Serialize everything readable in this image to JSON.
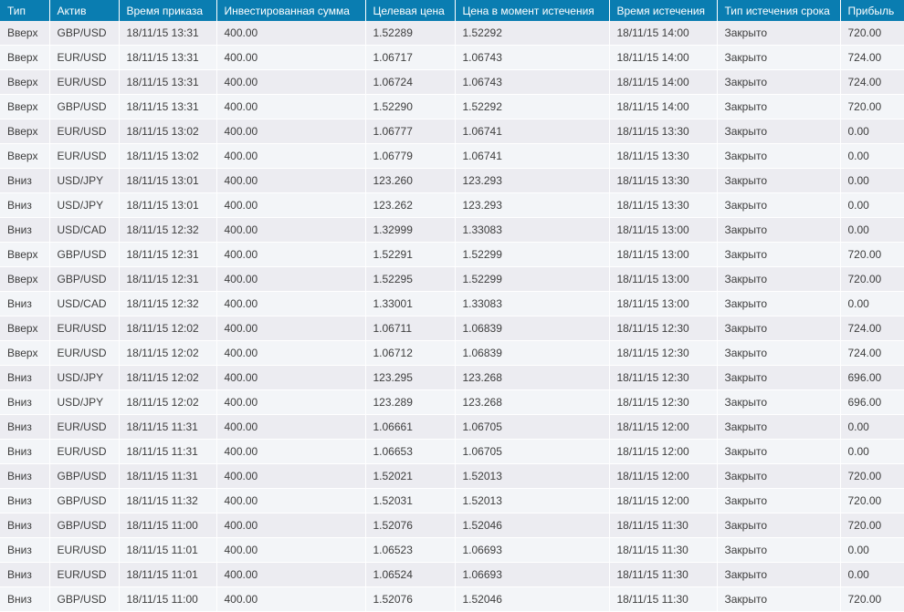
{
  "headers": [
    "Тип",
    "Актив",
    "Время приказа",
    "Инвестированная сумма",
    "Целевая цена",
    "Цена в момент истечения",
    "Время истечения",
    "Тип истечения срока",
    "Прибыль"
  ],
  "rows": [
    [
      "Вверх",
      "GBP/USD",
      "18/11/15 13:31",
      "400.00",
      "1.52289",
      "1.52292",
      "18/11/15 14:00",
      "Закрыто",
      "720.00"
    ],
    [
      "Вверх",
      "EUR/USD",
      "18/11/15 13:31",
      "400.00",
      "1.06717",
      "1.06743",
      "18/11/15 14:00",
      "Закрыто",
      "724.00"
    ],
    [
      "Вверх",
      "EUR/USD",
      "18/11/15 13:31",
      "400.00",
      "1.06724",
      "1.06743",
      "18/11/15 14:00",
      "Закрыто",
      "724.00"
    ],
    [
      "Вверх",
      "GBP/USD",
      "18/11/15 13:31",
      "400.00",
      "1.52290",
      "1.52292",
      "18/11/15 14:00",
      "Закрыто",
      "720.00"
    ],
    [
      "Вверх",
      "EUR/USD",
      "18/11/15 13:02",
      "400.00",
      "1.06777",
      "1.06741",
      "18/11/15 13:30",
      "Закрыто",
      "0.00"
    ],
    [
      "Вверх",
      "EUR/USD",
      "18/11/15 13:02",
      "400.00",
      "1.06779",
      "1.06741",
      "18/11/15 13:30",
      "Закрыто",
      "0.00"
    ],
    [
      "Вниз",
      "USD/JPY",
      "18/11/15 13:01",
      "400.00",
      "123.260",
      "123.293",
      "18/11/15 13:30",
      "Закрыто",
      "0.00"
    ],
    [
      "Вниз",
      "USD/JPY",
      "18/11/15 13:01",
      "400.00",
      "123.262",
      "123.293",
      "18/11/15 13:30",
      "Закрыто",
      "0.00"
    ],
    [
      "Вниз",
      "USD/CAD",
      "18/11/15 12:32",
      "400.00",
      "1.32999",
      "1.33083",
      "18/11/15 13:00",
      "Закрыто",
      "0.00"
    ],
    [
      "Вверх",
      "GBP/USD",
      "18/11/15 12:31",
      "400.00",
      "1.52291",
      "1.52299",
      "18/11/15 13:00",
      "Закрыто",
      "720.00"
    ],
    [
      "Вверх",
      "GBP/USD",
      "18/11/15 12:31",
      "400.00",
      "1.52295",
      "1.52299",
      "18/11/15 13:00",
      "Закрыто",
      "720.00"
    ],
    [
      "Вниз",
      "USD/CAD",
      "18/11/15 12:32",
      "400.00",
      "1.33001",
      "1.33083",
      "18/11/15 13:00",
      "Закрыто",
      "0.00"
    ],
    [
      "Вверх",
      "EUR/USD",
      "18/11/15 12:02",
      "400.00",
      "1.06711",
      "1.06839",
      "18/11/15 12:30",
      "Закрыто",
      "724.00"
    ],
    [
      "Вверх",
      "EUR/USD",
      "18/11/15 12:02",
      "400.00",
      "1.06712",
      "1.06839",
      "18/11/15 12:30",
      "Закрыто",
      "724.00"
    ],
    [
      "Вниз",
      "USD/JPY",
      "18/11/15 12:02",
      "400.00",
      "123.295",
      "123.268",
      "18/11/15 12:30",
      "Закрыто",
      "696.00"
    ],
    [
      "Вниз",
      "USD/JPY",
      "18/11/15 12:02",
      "400.00",
      "123.289",
      "123.268",
      "18/11/15 12:30",
      "Закрыто",
      "696.00"
    ],
    [
      "Вниз",
      "EUR/USD",
      "18/11/15 11:31",
      "400.00",
      "1.06661",
      "1.06705",
      "18/11/15 12:00",
      "Закрыто",
      "0.00"
    ],
    [
      "Вниз",
      "EUR/USD",
      "18/11/15 11:31",
      "400.00",
      "1.06653",
      "1.06705",
      "18/11/15 12:00",
      "Закрыто",
      "0.00"
    ],
    [
      "Вниз",
      "GBP/USD",
      "18/11/15 11:31",
      "400.00",
      "1.52021",
      "1.52013",
      "18/11/15 12:00",
      "Закрыто",
      "720.00"
    ],
    [
      "Вниз",
      "GBP/USD",
      "18/11/15 11:32",
      "400.00",
      "1.52031",
      "1.52013",
      "18/11/15 12:00",
      "Закрыто",
      "720.00"
    ],
    [
      "Вниз",
      "GBP/USD",
      "18/11/15 11:00",
      "400.00",
      "1.52076",
      "1.52046",
      "18/11/15 11:30",
      "Закрыто",
      "720.00"
    ],
    [
      "Вниз",
      "EUR/USD",
      "18/11/15 11:01",
      "400.00",
      "1.06523",
      "1.06693",
      "18/11/15 11:30",
      "Закрыто",
      "0.00"
    ],
    [
      "Вниз",
      "EUR/USD",
      "18/11/15 11:01",
      "400.00",
      "1.06524",
      "1.06693",
      "18/11/15 11:30",
      "Закрыто",
      "0.00"
    ],
    [
      "Вниз",
      "GBP/USD",
      "18/11/15 11:00",
      "400.00",
      "1.52076",
      "1.52046",
      "18/11/15 11:30",
      "Закрыто",
      "720.00"
    ]
  ]
}
